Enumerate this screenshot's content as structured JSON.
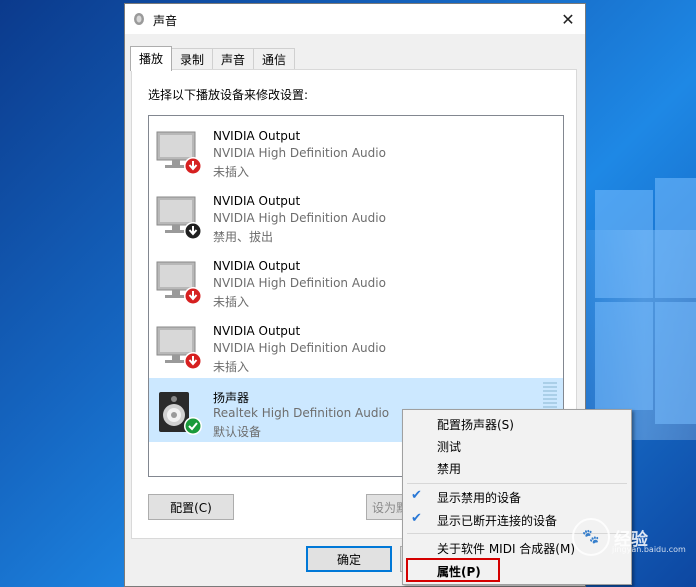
{
  "window": {
    "title": "声音"
  },
  "tabs": [
    {
      "label": "播放"
    },
    {
      "label": "录制"
    },
    {
      "label": "声音"
    },
    {
      "label": "通信"
    }
  ],
  "playback": {
    "instruction": "选择以下播放设备来修改设置:",
    "devices": [
      {
        "name": "NVIDIA Output",
        "driver": "NVIDIA High Definition Audio",
        "status": "未插入",
        "icon": "monitor-icon",
        "badge": "red-down-arrow"
      },
      {
        "name": "NVIDIA Output",
        "driver": "NVIDIA High Definition Audio",
        "status": "禁用、拔出",
        "icon": "monitor-icon",
        "badge": "black-down-arrow"
      },
      {
        "name": "NVIDIA Output",
        "driver": "NVIDIA High Definition Audio",
        "status": "未插入",
        "icon": "monitor-icon",
        "badge": "red-down-arrow"
      },
      {
        "name": "NVIDIA Output",
        "driver": "NVIDIA High Definition Audio",
        "status": "未插入",
        "icon": "monitor-icon",
        "badge": "red-down-arrow"
      },
      {
        "name": "扬声器",
        "driver": "Realtek High Definition Audio",
        "status": "默认设备",
        "icon": "speaker-icon",
        "badge": "green-check",
        "selected": true
      }
    ]
  },
  "buttons": {
    "configure": "配置(C)",
    "set_default": "设为默",
    "ok": "确定"
  },
  "context_menu": {
    "items": [
      {
        "label": "配置扬声器(S)"
      },
      {
        "label": "测试"
      },
      {
        "label": "禁用"
      },
      {
        "label": "显示禁用的设备",
        "checked": true
      },
      {
        "label": "显示已断开连接的设备",
        "checked": true
      },
      {
        "label": "关于软件 MIDI 合成器(M)"
      },
      {
        "label": "属性(P)",
        "highlighted": true
      }
    ]
  },
  "watermark": {
    "text": "经验",
    "sub": "jingyan.baidu.com"
  },
  "colors": {
    "accent": "#0078d7",
    "selection": "#cce8ff",
    "highlight_box": "#d40000",
    "desktop": "#1565c0"
  }
}
